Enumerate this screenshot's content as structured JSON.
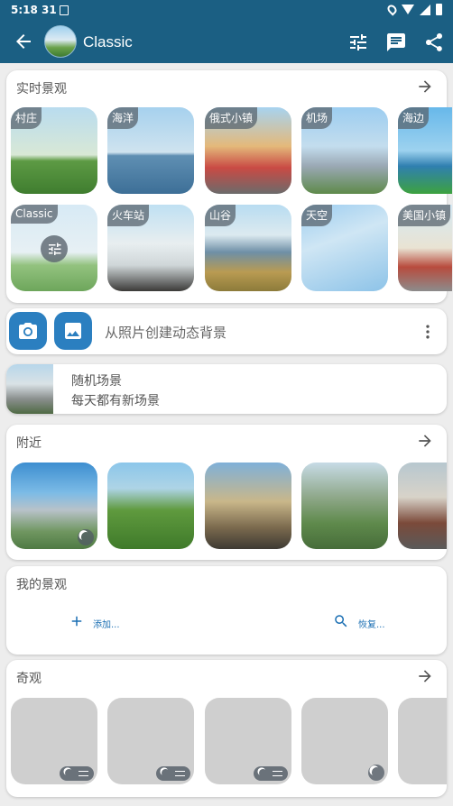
{
  "status_bar": {
    "time": "5:18",
    "temp": "31"
  },
  "app_bar": {
    "title": "Classic"
  },
  "live": {
    "title": "实时景观",
    "row1": [
      "村庄",
      "海洋",
      "俄式小镇",
      "机场",
      "海边"
    ],
    "row2": [
      "Classic",
      "火车站",
      "山谷",
      "天空",
      "美国小镇"
    ]
  },
  "create": {
    "label": "从照片创建动态背景"
  },
  "random": {
    "title": "随机场景",
    "subtitle": "每天都有新场景"
  },
  "nearby": {
    "title": "附近"
  },
  "mine": {
    "title": "我的景观",
    "add": "添加...",
    "restore": "恢复..."
  },
  "wonders": {
    "title": "奇观"
  },
  "colors": {
    "appbar": "#1b5f83",
    "accent": "#2b7fc0",
    "tile_placeholder": "#cfcfcf"
  },
  "icons": [
    "back-arrow-icon",
    "sliders-icon",
    "chat-icon",
    "share-icon",
    "arrow-right-icon",
    "camera-icon",
    "image-icon",
    "more-vert-icon",
    "plus-icon",
    "search-icon",
    "moon-icon"
  ]
}
